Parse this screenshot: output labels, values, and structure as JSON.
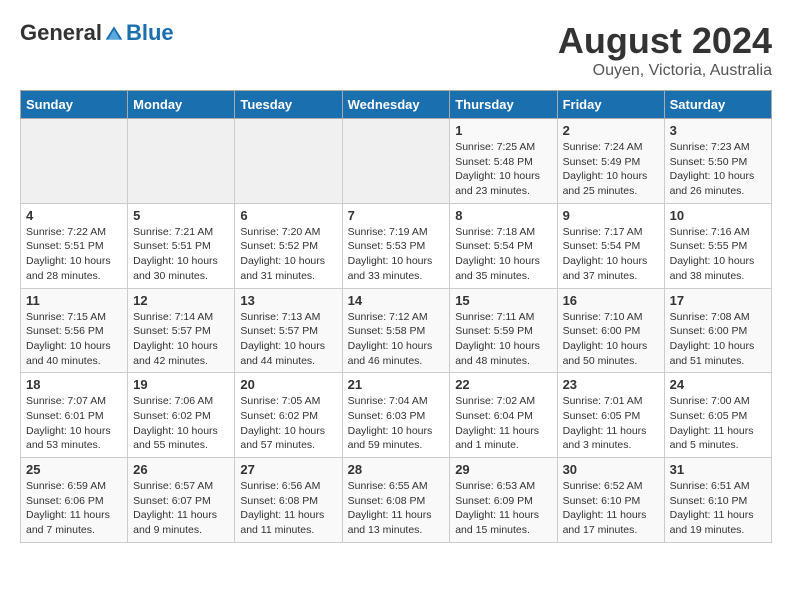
{
  "header": {
    "logo_general": "General",
    "logo_blue": "Blue",
    "month_year": "August 2024",
    "location": "Ouyen, Victoria, Australia"
  },
  "days_of_week": [
    "Sunday",
    "Monday",
    "Tuesday",
    "Wednesday",
    "Thursday",
    "Friday",
    "Saturday"
  ],
  "weeks": [
    [
      {
        "day": "",
        "info": ""
      },
      {
        "day": "",
        "info": ""
      },
      {
        "day": "",
        "info": ""
      },
      {
        "day": "",
        "info": ""
      },
      {
        "day": "1",
        "info": "Sunrise: 7:25 AM\nSunset: 5:48 PM\nDaylight: 10 hours\nand 23 minutes."
      },
      {
        "day": "2",
        "info": "Sunrise: 7:24 AM\nSunset: 5:49 PM\nDaylight: 10 hours\nand 25 minutes."
      },
      {
        "day": "3",
        "info": "Sunrise: 7:23 AM\nSunset: 5:50 PM\nDaylight: 10 hours\nand 26 minutes."
      }
    ],
    [
      {
        "day": "4",
        "info": "Sunrise: 7:22 AM\nSunset: 5:51 PM\nDaylight: 10 hours\nand 28 minutes."
      },
      {
        "day": "5",
        "info": "Sunrise: 7:21 AM\nSunset: 5:51 PM\nDaylight: 10 hours\nand 30 minutes."
      },
      {
        "day": "6",
        "info": "Sunrise: 7:20 AM\nSunset: 5:52 PM\nDaylight: 10 hours\nand 31 minutes."
      },
      {
        "day": "7",
        "info": "Sunrise: 7:19 AM\nSunset: 5:53 PM\nDaylight: 10 hours\nand 33 minutes."
      },
      {
        "day": "8",
        "info": "Sunrise: 7:18 AM\nSunset: 5:54 PM\nDaylight: 10 hours\nand 35 minutes."
      },
      {
        "day": "9",
        "info": "Sunrise: 7:17 AM\nSunset: 5:54 PM\nDaylight: 10 hours\nand 37 minutes."
      },
      {
        "day": "10",
        "info": "Sunrise: 7:16 AM\nSunset: 5:55 PM\nDaylight: 10 hours\nand 38 minutes."
      }
    ],
    [
      {
        "day": "11",
        "info": "Sunrise: 7:15 AM\nSunset: 5:56 PM\nDaylight: 10 hours\nand 40 minutes."
      },
      {
        "day": "12",
        "info": "Sunrise: 7:14 AM\nSunset: 5:57 PM\nDaylight: 10 hours\nand 42 minutes."
      },
      {
        "day": "13",
        "info": "Sunrise: 7:13 AM\nSunset: 5:57 PM\nDaylight: 10 hours\nand 44 minutes."
      },
      {
        "day": "14",
        "info": "Sunrise: 7:12 AM\nSunset: 5:58 PM\nDaylight: 10 hours\nand 46 minutes."
      },
      {
        "day": "15",
        "info": "Sunrise: 7:11 AM\nSunset: 5:59 PM\nDaylight: 10 hours\nand 48 minutes."
      },
      {
        "day": "16",
        "info": "Sunrise: 7:10 AM\nSunset: 6:00 PM\nDaylight: 10 hours\nand 50 minutes."
      },
      {
        "day": "17",
        "info": "Sunrise: 7:08 AM\nSunset: 6:00 PM\nDaylight: 10 hours\nand 51 minutes."
      }
    ],
    [
      {
        "day": "18",
        "info": "Sunrise: 7:07 AM\nSunset: 6:01 PM\nDaylight: 10 hours\nand 53 minutes."
      },
      {
        "day": "19",
        "info": "Sunrise: 7:06 AM\nSunset: 6:02 PM\nDaylight: 10 hours\nand 55 minutes."
      },
      {
        "day": "20",
        "info": "Sunrise: 7:05 AM\nSunset: 6:02 PM\nDaylight: 10 hours\nand 57 minutes."
      },
      {
        "day": "21",
        "info": "Sunrise: 7:04 AM\nSunset: 6:03 PM\nDaylight: 10 hours\nand 59 minutes."
      },
      {
        "day": "22",
        "info": "Sunrise: 7:02 AM\nSunset: 6:04 PM\nDaylight: 11 hours\nand 1 minute."
      },
      {
        "day": "23",
        "info": "Sunrise: 7:01 AM\nSunset: 6:05 PM\nDaylight: 11 hours\nand 3 minutes."
      },
      {
        "day": "24",
        "info": "Sunrise: 7:00 AM\nSunset: 6:05 PM\nDaylight: 11 hours\nand 5 minutes."
      }
    ],
    [
      {
        "day": "25",
        "info": "Sunrise: 6:59 AM\nSunset: 6:06 PM\nDaylight: 11 hours\nand 7 minutes."
      },
      {
        "day": "26",
        "info": "Sunrise: 6:57 AM\nSunset: 6:07 PM\nDaylight: 11 hours\nand 9 minutes."
      },
      {
        "day": "27",
        "info": "Sunrise: 6:56 AM\nSunset: 6:08 PM\nDaylight: 11 hours\nand 11 minutes."
      },
      {
        "day": "28",
        "info": "Sunrise: 6:55 AM\nSunset: 6:08 PM\nDaylight: 11 hours\nand 13 minutes."
      },
      {
        "day": "29",
        "info": "Sunrise: 6:53 AM\nSunset: 6:09 PM\nDaylight: 11 hours\nand 15 minutes."
      },
      {
        "day": "30",
        "info": "Sunrise: 6:52 AM\nSunset: 6:10 PM\nDaylight: 11 hours\nand 17 minutes."
      },
      {
        "day": "31",
        "info": "Sunrise: 6:51 AM\nSunset: 6:10 PM\nDaylight: 11 hours\nand 19 minutes."
      }
    ]
  ]
}
